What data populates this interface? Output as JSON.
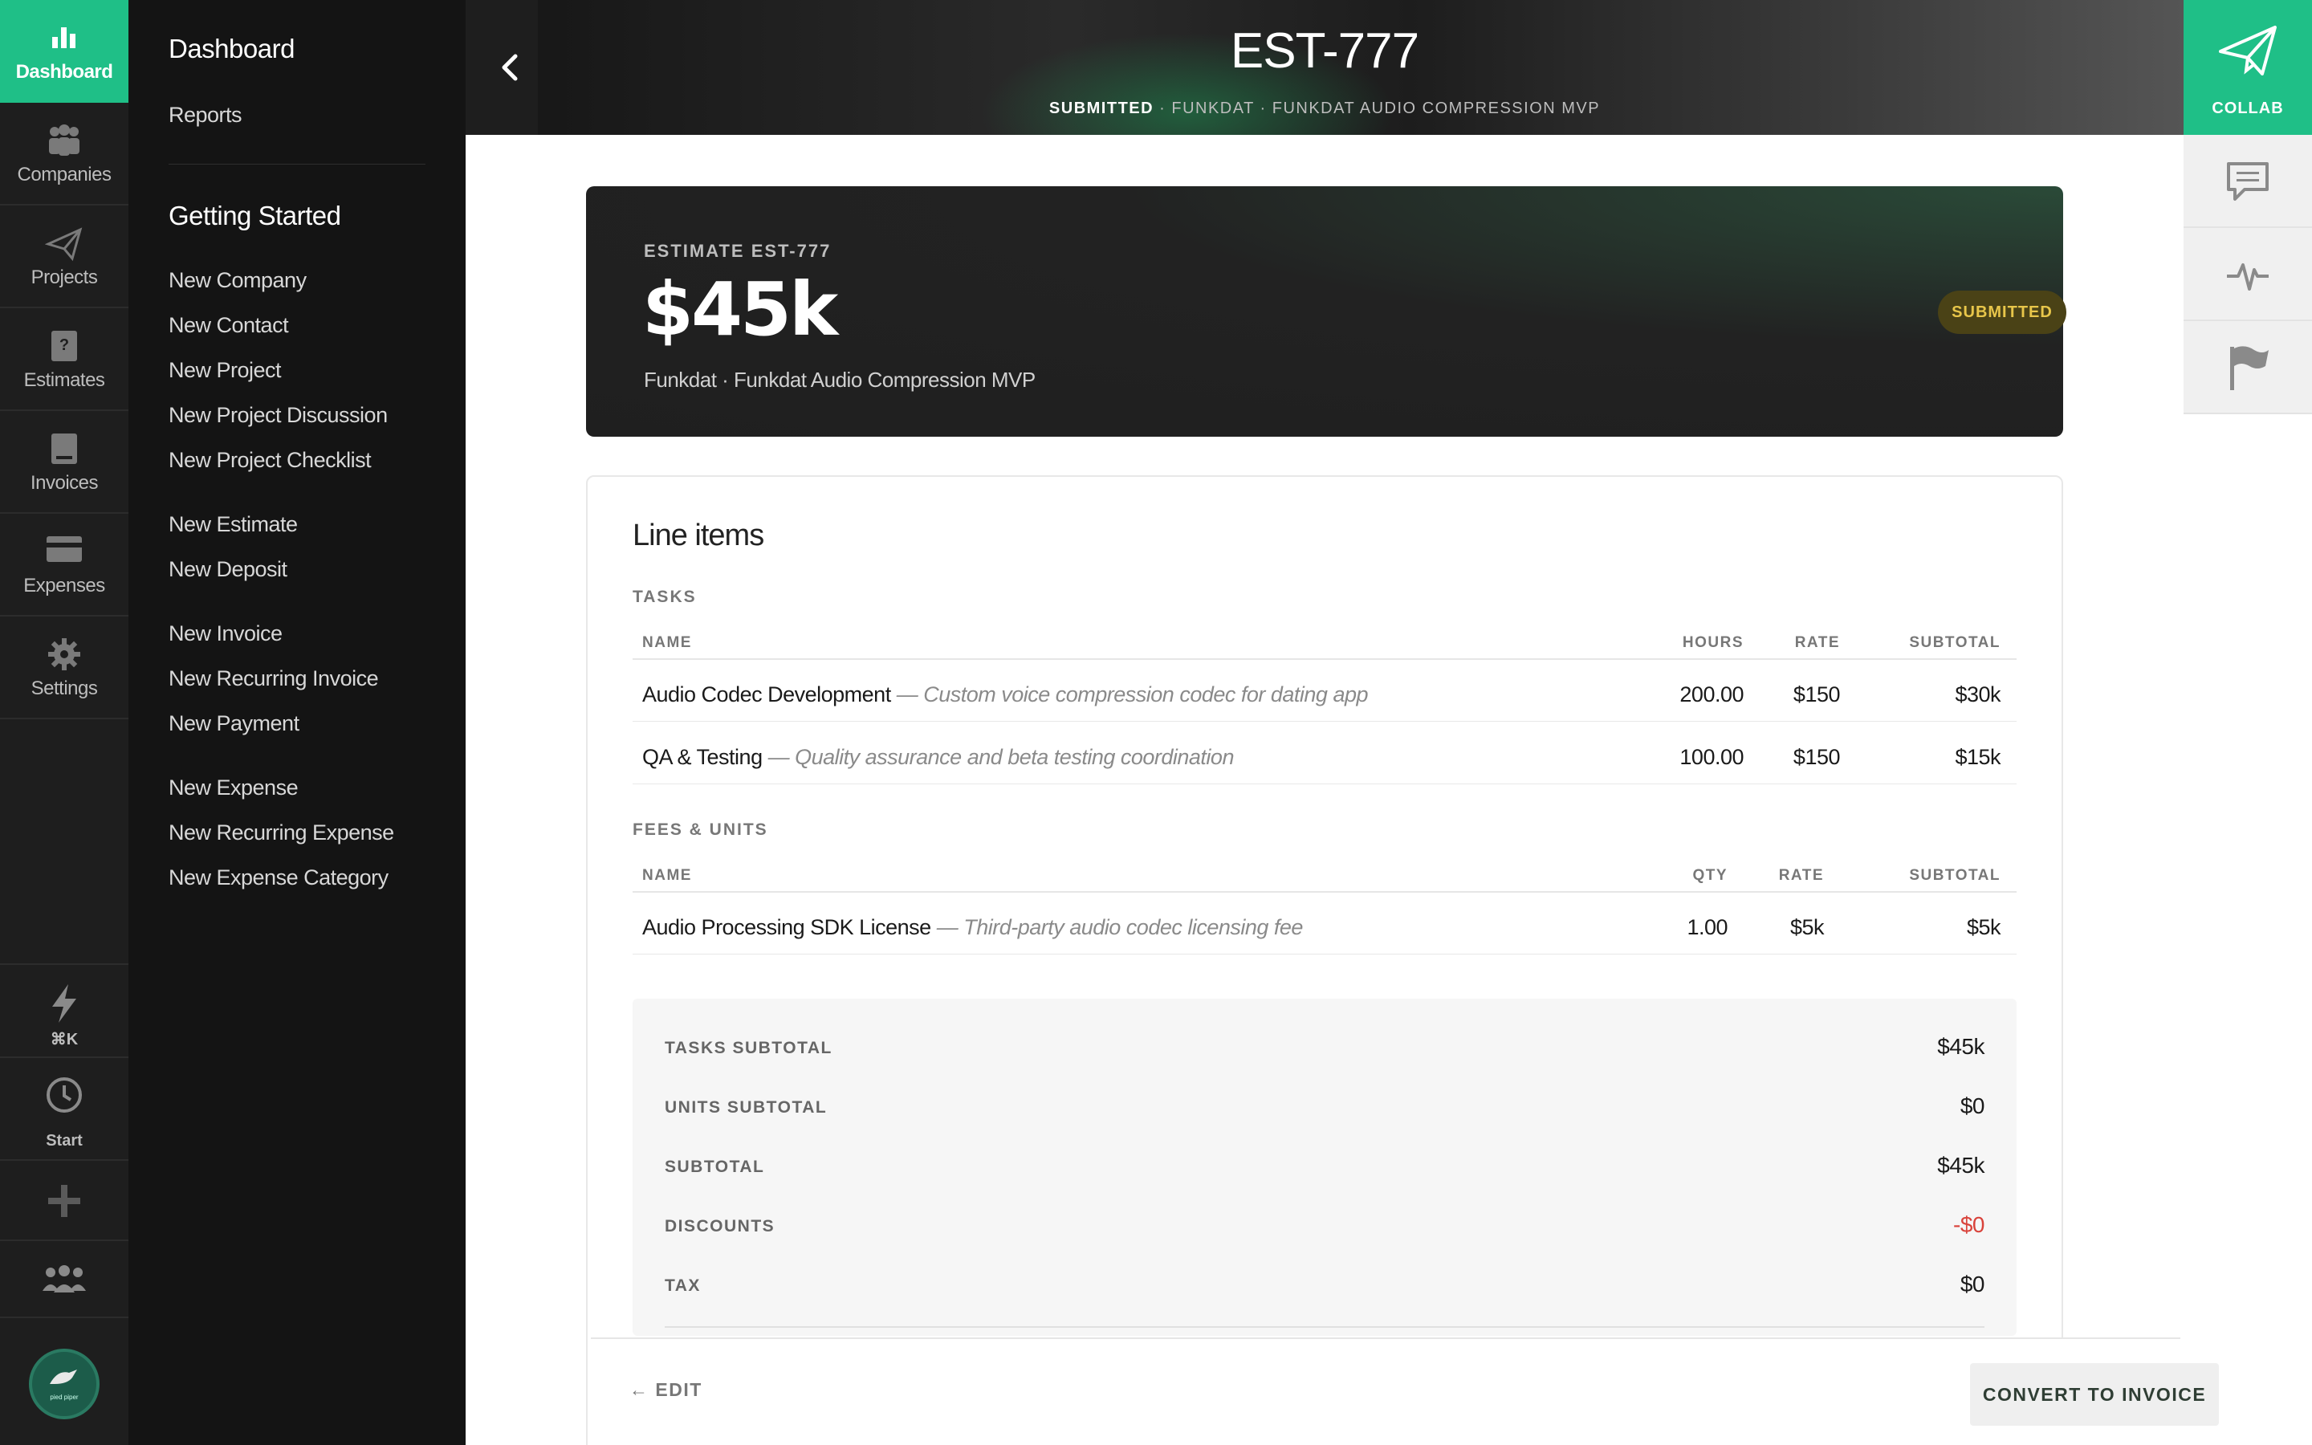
{
  "rail": {
    "items": [
      {
        "label": "Dashboard",
        "icon": "bar-chart-icon"
      },
      {
        "label": "Companies",
        "icon": "people-icon"
      },
      {
        "label": "Projects",
        "icon": "paper-plane-icon"
      },
      {
        "label": "Estimates",
        "icon": "estimate-doc-icon"
      },
      {
        "label": "Invoices",
        "icon": "invoice-doc-icon"
      },
      {
        "label": "Expenses",
        "icon": "credit-card-icon"
      },
      {
        "label": "Settings",
        "icon": "gear-icon"
      }
    ],
    "bottom": {
      "quick_label": "⌘K",
      "start_label": "Start",
      "avatar_text": "pied piper"
    }
  },
  "nav": {
    "top": [
      "Dashboard",
      "Reports"
    ],
    "section_title": "Getting Started",
    "groups": [
      [
        "New Company",
        "New Contact",
        "New Project",
        "New Project Discussion",
        "New Project Checklist"
      ],
      [
        "New Estimate",
        "New Deposit"
      ],
      [
        "New Invoice",
        "New Recurring Invoice",
        "New Payment"
      ],
      [
        "New Expense",
        "New Recurring Expense",
        "New Expense Category"
      ]
    ]
  },
  "header": {
    "title": "EST-777",
    "status": "SUBMITTED",
    "subtitle": " · FUNKDAT · FUNKDAT AUDIO COMPRESSION MVP"
  },
  "right_rail": {
    "collab_label": "COLLAB"
  },
  "card": {
    "label": "ESTIMATE EST-777",
    "amount": "$45k",
    "subtitle": "Funkdat · Funkdat Audio Compression MVP",
    "badge": "SUBMITTED",
    "badge_color": "#e8c64a"
  },
  "line_items": {
    "title": "Line items",
    "tasks_label": "TASKS",
    "task_headers": {
      "name": "NAME",
      "hours": "HOURS",
      "rate": "RATE",
      "subtotal": "SUBTOTAL"
    },
    "tasks": [
      {
        "name": "Audio Codec Development",
        "desc": " — Custom voice compression codec for dating app",
        "hours": "200.00",
        "rate": "$150",
        "subtotal": "$30k"
      },
      {
        "name": "QA & Testing",
        "desc": " — Quality assurance and beta testing coordination",
        "hours": "100.00",
        "rate": "$150",
        "subtotal": "$15k"
      }
    ],
    "fees_label": "FEES & UNITS",
    "fee_headers": {
      "name": "NAME",
      "qty": "QTY",
      "rate": "RATE",
      "subtotal": "SUBTOTAL"
    },
    "fees": [
      {
        "name": "Audio Processing SDK License",
        "desc": " — Third-party audio codec licensing fee",
        "qty": "1.00",
        "rate": "$5k",
        "subtotal": "$5k"
      }
    ]
  },
  "totals": [
    {
      "label": "TASKS SUBTOTAL",
      "value": "$45k"
    },
    {
      "label": "UNITS SUBTOTAL",
      "value": "$0"
    },
    {
      "label": "SUBTOTAL",
      "value": "$45k"
    },
    {
      "label": "DISCOUNTS",
      "value": "-$0"
    },
    {
      "label": "TAX",
      "value": "$0"
    }
  ],
  "footer": {
    "edit_label": "← EDIT",
    "convert_label": "CONVERT TO INVOICE"
  },
  "colors": {
    "accent": "#1fbf87",
    "negative": "#d9433b"
  }
}
